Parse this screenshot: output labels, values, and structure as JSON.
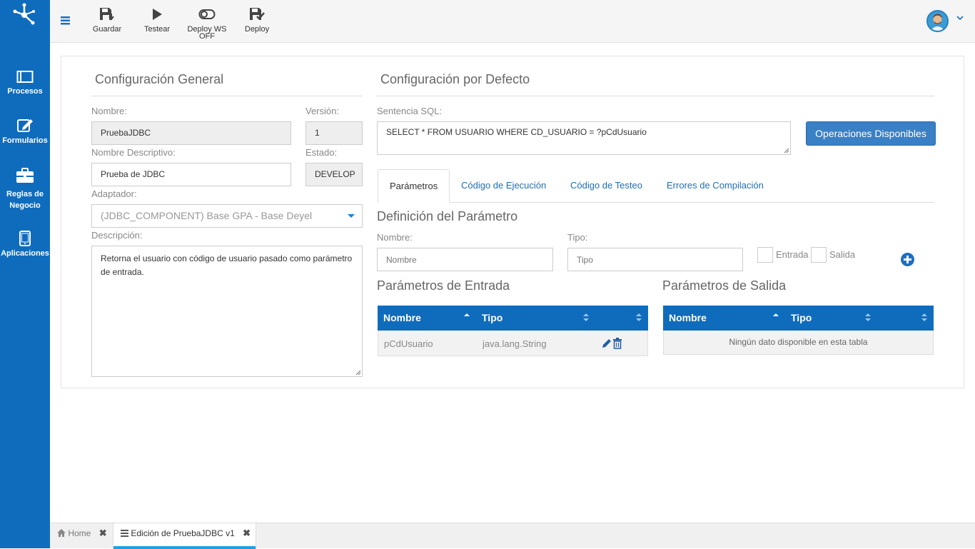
{
  "sidebar": {
    "items": [
      {
        "label": "Procesos"
      },
      {
        "label": "Formularios"
      },
      {
        "label": "Reglas de Negocio"
      },
      {
        "label": "Aplicaciones"
      }
    ]
  },
  "toolbar": {
    "save_label": "Guardar",
    "test_label": "Testear",
    "deploy_ws_label": "Deploy WS",
    "deploy_ws_state": "OFF",
    "deploy_label": "Deploy"
  },
  "general": {
    "title": "Configuración General",
    "name_label": "Nombre:",
    "name_value": "PruebaJDBC",
    "version_label": "Versión:",
    "version_value": "1",
    "desc_name_label": "Nombre Descriptivo:",
    "desc_name_value": "Prueba de JDBC",
    "status_label": "Estado:",
    "status_value": "DEVELOP",
    "adapter_label": "Adaptador:",
    "adapter_value": "(JDBC_COMPONENT) Base GPA - Base Deyel",
    "description_label": "Descripción:",
    "description_value": "Retorna el usuario con código de usuario pasado como parámetro de entrada."
  },
  "defaults": {
    "title": "Configuración por Defecto",
    "sql_label": "Sentencia SQL:",
    "sql_value": "SELECT * FROM USUARIO WHERE CD_USUARIO = ?pCdUsuario",
    "ops_button": "Operaciones Disponibles"
  },
  "tabs": [
    {
      "label": "Parámetros",
      "active": true
    },
    {
      "label": "Código de Ejecución",
      "active": false
    },
    {
      "label": "Código de Testeo",
      "active": false
    },
    {
      "label": "Errores de Compilación",
      "active": false
    }
  ],
  "param_def": {
    "title": "Definición del Parámetro",
    "name_label": "Nombre:",
    "name_placeholder": "Nombre",
    "type_label": "Tipo:",
    "type_placeholder": "Tipo",
    "in_label": "Entrada",
    "out_label": "Salida"
  },
  "input_params": {
    "title": "Parámetros de Entrada",
    "columns": [
      "Nombre",
      "Tipo"
    ],
    "rows": [
      {
        "name": "pCdUsuario",
        "type": "java.lang.String"
      }
    ]
  },
  "output_params": {
    "title": "Parámetros de Salida",
    "columns": [
      "Nombre",
      "Tipo"
    ],
    "empty_text": "Ningún dato disponible en esta tabla"
  },
  "bottom_tabs": [
    {
      "label": "Home"
    },
    {
      "label": "Edición de PruebaJDBC v1"
    }
  ],
  "colors": {
    "sidebar": "#0f6cbd",
    "accent": "#1f6fb5",
    "table_header": "#0f6cbd"
  }
}
